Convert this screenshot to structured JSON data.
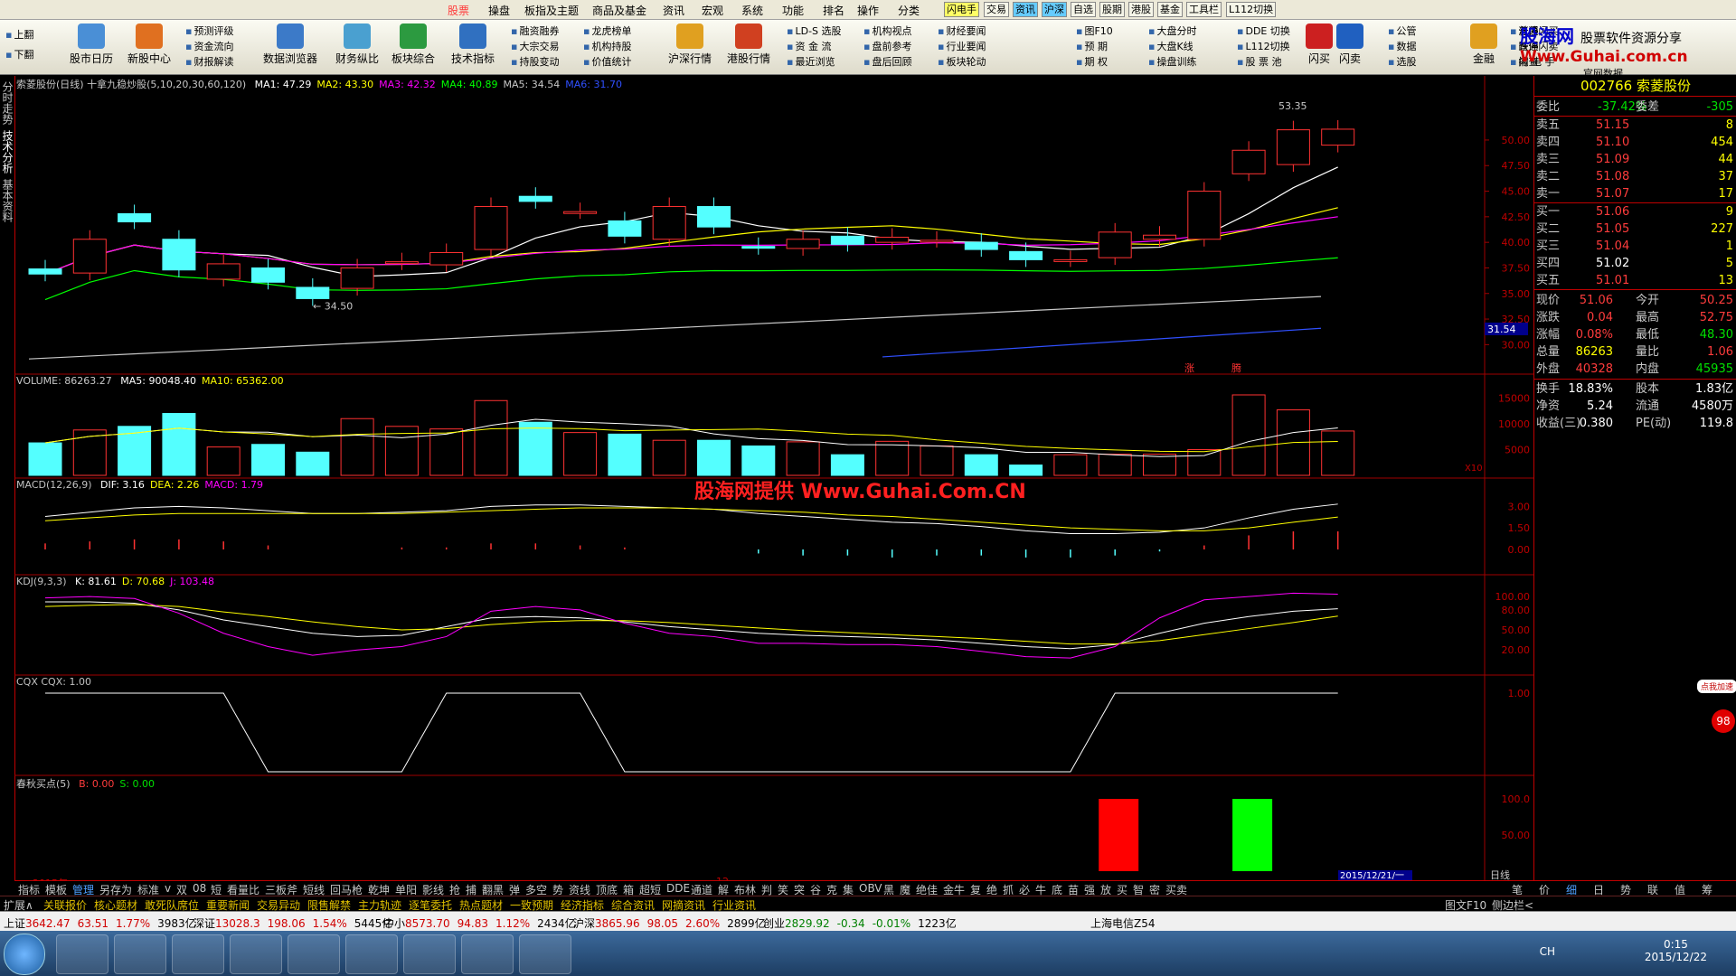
{
  "menubar": {
    "items": [
      "股票",
      "操盘",
      "板指及主题",
      "商品及基金",
      "资讯",
      "宏观",
      "系统",
      "功能",
      "排名",
      "操作",
      "分类"
    ],
    "chips": [
      "闪电手",
      "交易",
      "资讯",
      "沪深",
      "自选",
      "股期",
      "港股",
      "基金",
      "工具栏",
      "L112切换"
    ]
  },
  "toolbar": {
    "big": [
      "股市日历",
      "新股中心",
      "数据浏览器",
      "财务纵比",
      "板块综合",
      "技术指标",
      "沪深行情",
      "港股行情",
      "闪买",
      "闪卖",
      "金融"
    ],
    "small": [
      "预测评级",
      "资金流向",
      "财报解读",
      "融资融券",
      "大宗交易",
      "持股变动",
      "龙虎榜单",
      "机构持股",
      "价值统计",
      "LD-S 选股",
      "资 金 流",
      "最近浏览",
      "机构视点",
      "盘前参考",
      "盘后回顾",
      "财经要闻",
      "行业要闻",
      "板块轮动",
      "图F10",
      "预  期",
      "期  权",
      "大盘分时",
      "大盘K线",
      "操盘训练",
      "DDE 切换",
      "L112切换",
      "股 票 池",
      "公管",
      "数据",
      "选股",
      "涨停闪买",
      "跌停闪卖",
      "闪 电 手",
      "普通",
      "普通",
      "撤查"
    ],
    "side": [
      "上翻",
      "下翻"
    ],
    "watermark": [
      "股海网",
      "股票软件资源分享",
      "Www.Guhai.com.cn",
      "官网数据"
    ]
  },
  "lefttabs": [
    "分时走势",
    "技术分析",
    "基本资料"
  ],
  "chart": {
    "main_title": "索菱股份(日线) 十拿九稳炒股(5,10,20,30,60,120)",
    "ma_labels": [
      {
        "text": "MA1: 47.29",
        "color": "#ffffff"
      },
      {
        "text": "MA2: 43.30",
        "color": "#ffff00"
      },
      {
        "text": "MA3: 42.32",
        "color": "#ff00ff"
      },
      {
        "text": "MA4: 40.89",
        "color": "#00ff00"
      },
      {
        "text": "MA5: 34.54",
        "color": "#c8c8c8"
      },
      {
        "text": "MA6: 31.70",
        "color": "#3050ff"
      }
    ],
    "price_axis": [
      "50.00",
      "47.50",
      "45.00",
      "42.50",
      "40.00",
      "37.50",
      "35.00",
      "32.50",
      "30.00"
    ],
    "current_price_label": "31.54",
    "high_label": "53.35",
    "low_label": "34.50",
    "signal_text": [
      "涨",
      "腾"
    ],
    "volume_title": "VOLUME: 86263.27",
    "volume_ma": [
      {
        "text": "MA5: 90048.40",
        "color": "#ffffff"
      },
      {
        "text": "MA10: 65362.00",
        "color": "#ffff00"
      }
    ],
    "volume_axis": [
      "15000",
      "10000",
      "5000"
    ],
    "volume_unit": "X10",
    "macd_title": "MACD(12,26,9)",
    "macd_vals": [
      {
        "text": "DIF: 3.16",
        "color": "#ffffff"
      },
      {
        "text": "DEA: 2.26",
        "color": "#ffff00"
      },
      {
        "text": "MACD: 1.79",
        "color": "#ff00ff"
      }
    ],
    "macd_axis": [
      "3.00",
      "1.50",
      "0.00"
    ],
    "macd_watermark": "股海网提供 Www.Guhai.Com.CN",
    "kdj_title": "KDJ(9,3,3)",
    "kdj_vals": [
      {
        "text": "K: 81.61",
        "color": "#ffffff"
      },
      {
        "text": "D: 70.68",
        "color": "#ffff00"
      },
      {
        "text": "J: 103.48",
        "color": "#ff00ff"
      }
    ],
    "kdj_axis": [
      "100.00",
      "80.00",
      "50.00",
      "20.00"
    ],
    "cqx_title": "CQX  CQX: 1.00",
    "cqx_axis": [
      "1.00"
    ],
    "cq_title": "春秋买点(5)",
    "cq_vals": [
      {
        "text": "B: 0.00",
        "color": "#ff3c3c"
      },
      {
        "text": "S: 0.00",
        "color": "#00e000"
      }
    ],
    "cq_axis": [
      "100.0",
      "50.00"
    ],
    "date_left": "2015年",
    "date_mid": "12",
    "date_cursor": "2015/12/21/一",
    "period": "日线"
  },
  "chart_data": {
    "type": "candlestick",
    "title": "索菱股份(日线)",
    "candles": [
      {
        "o": 37.4,
        "c": 36.9
      },
      {
        "o": 37.0,
        "c": 40.3
      },
      {
        "o": 42.8,
        "c": 42.0
      },
      {
        "o": 40.3,
        "c": 37.3
      },
      {
        "o": 36.4,
        "c": 37.9
      },
      {
        "o": 37.5,
        "c": 36.1
      },
      {
        "o": 35.6,
        "c": 34.5
      },
      {
        "o": 35.5,
        "c": 37.5
      },
      {
        "o": 38.0,
        "c": 38.1
      },
      {
        "o": 37.8,
        "c": 39.0
      },
      {
        "o": 39.3,
        "c": 43.5
      },
      {
        "o": 44.5,
        "c": 44.0
      },
      {
        "o": 43.0,
        "c": 43.0
      },
      {
        "o": 42.1,
        "c": 40.6
      },
      {
        "o": 40.3,
        "c": 43.5
      },
      {
        "o": 43.5,
        "c": 41.5
      },
      {
        "o": 39.6,
        "c": 39.5
      },
      {
        "o": 39.4,
        "c": 40.3
      },
      {
        "o": 40.6,
        "c": 39.8
      },
      {
        "o": 40.0,
        "c": 40.5
      },
      {
        "o": 40.2,
        "c": 40.2
      },
      {
        "o": 40.0,
        "c": 39.3
      },
      {
        "o": 39.1,
        "c": 38.3
      },
      {
        "o": 38.3,
        "c": 38.3
      },
      {
        "o": 38.5,
        "c": 41.0
      },
      {
        "o": 40.3,
        "c": 40.7
      },
      {
        "o": 40.3,
        "c": 45.0
      },
      {
        "o": 46.7,
        "c": 49.0
      },
      {
        "o": 47.6,
        "c": 51.0
      },
      {
        "o": 49.5,
        "c": 51.06
      }
    ],
    "volume": [
      6300,
      8800,
      9500,
      12000,
      5500,
      6000,
      4500,
      11000,
      9500,
      9000,
      14500,
      10300,
      8300,
      8000,
      6800,
      6800,
      5700,
      6500,
      4000,
      6600,
      5700,
      4000,
      2000,
      4000,
      4100,
      4100,
      5000,
      15600,
      12700,
      8600
    ]
  },
  "quote": {
    "code": "002766",
    "name": "索菱股份",
    "weibi": {
      "label": "委比",
      "value": "-37.42%",
      "label2": "委差",
      "value2": "-305"
    },
    "asks": [
      {
        "label": "卖五",
        "price": "51.15",
        "vol": "8"
      },
      {
        "label": "卖四",
        "price": "51.10",
        "vol": "454"
      },
      {
        "label": "卖三",
        "price": "51.09",
        "vol": "44"
      },
      {
        "label": "卖二",
        "price": "51.08",
        "vol": "37"
      },
      {
        "label": "卖一",
        "price": "51.07",
        "vol": "17"
      }
    ],
    "bids": [
      {
        "label": "买一",
        "price": "51.06",
        "vol": "9"
      },
      {
        "label": "买二",
        "price": "51.05",
        "vol": "227"
      },
      {
        "label": "买三",
        "price": "51.04",
        "vol": "1"
      },
      {
        "label": "买四",
        "price": "51.02",
        "vol": "5"
      },
      {
        "label": "买五",
        "price": "51.01",
        "vol": "13"
      }
    ],
    "stats": [
      {
        "l1": "现价",
        "v1": "51.06",
        "l2": "今开",
        "v2": "50.25",
        "c1": "red",
        "c2": "red"
      },
      {
        "l1": "涨跌",
        "v1": "0.04",
        "l2": "最高",
        "v2": "52.75",
        "c1": "red",
        "c2": "red"
      },
      {
        "l1": "涨幅",
        "v1": "0.08%",
        "l2": "最低",
        "v2": "48.30",
        "c1": "red",
        "c2": "green"
      },
      {
        "l1": "总量",
        "v1": "86263",
        "l2": "量比",
        "v2": "1.06",
        "c1": "yellow",
        "c2": "red"
      },
      {
        "l1": "外盘",
        "v1": "40328",
        "l2": "内盘",
        "v2": "45935",
        "c1": "red",
        "c2": "green"
      },
      {
        "l1": "换手",
        "v1": "18.83%",
        "l2": "股本",
        "v2": "1.83亿",
        "c1": "white",
        "c2": "white"
      },
      {
        "l1": "净资",
        "v1": "5.24",
        "l2": "流通",
        "v2": "4580万",
        "c1": "white",
        "c2": "white"
      },
      {
        "l1": "收益(三)",
        "v1": "0.380",
        "l2": "PE(动)",
        "v2": "119.8",
        "c1": "white",
        "c2": "white"
      }
    ],
    "promo": "点我加速",
    "promo_num": "98"
  },
  "tabs1": [
    "指标",
    "模板",
    "管理",
    "另存为",
    "标准",
    "v",
    "双",
    "08",
    "短",
    "看量比",
    "三板斧",
    "短线",
    "回马枪",
    "乾坤",
    "单阳",
    "影线",
    "抢",
    "捕",
    "翻黑",
    "弹",
    "多空",
    "势",
    "资线",
    "顶底",
    "箱",
    "超短",
    "DDE",
    "通道",
    "解",
    "布林",
    "判",
    "笑",
    "突",
    "谷",
    "克",
    "集",
    "OBV",
    "黑",
    "魔",
    "绝佳",
    "金牛",
    "复",
    "绝",
    "抓",
    "必",
    "牛",
    "底",
    "苗",
    "强",
    "放",
    "买",
    "智",
    "密",
    "买卖"
  ],
  "tabs1_right": [
    "笔",
    "价",
    "细",
    "日",
    "势",
    "联",
    "值",
    "筹"
  ],
  "tabs2": [
    "扩展∧",
    "关联报价",
    "核心题材",
    "敢死队席位",
    "重要新闻",
    "交易异动",
    "限售解禁",
    "主力轨迹",
    "逐笔委托",
    "热点题材",
    "一致预期",
    "经济指标",
    "综合资讯",
    "网摘资讯",
    "行业资讯"
  ],
  "tabs2_right": [
    "图文F10",
    "侧边栏<"
  ],
  "indexbar": [
    {
      "name": "上证",
      "val": "3642.47",
      "chg": "63.51",
      "pct": "1.77%",
      "amt": "3983亿"
    },
    {
      "name": "深证",
      "val": "13028.3",
      "chg": "198.06",
      "pct": "1.54%",
      "amt": "5445亿"
    },
    {
      "name": "中小",
      "val": "8573.70",
      "chg": "94.83",
      "pct": "1.12%",
      "amt": "2434亿"
    },
    {
      "name": "沪深",
      "val": "3865.96",
      "chg": "98.05",
      "pct": "2.60%",
      "amt": "2899亿"
    },
    {
      "name": "创业",
      "val": "2829.92",
      "chg": "-0.34",
      "pct": "-0.01%",
      "amt": "1223亿"
    }
  ],
  "indexbar_right": "上海电信Z54",
  "taskbar": {
    "time": "0:15",
    "date": "2015/12/22",
    "lang": "CH"
  }
}
